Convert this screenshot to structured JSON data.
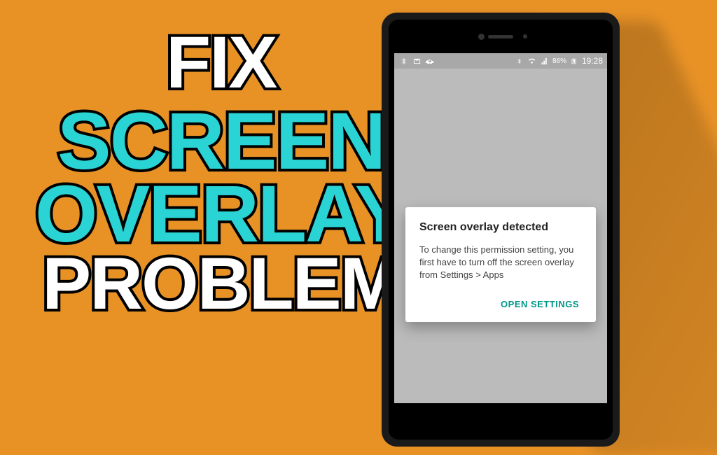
{
  "title": {
    "line1": "FIX",
    "line2": "SCREEN",
    "line3": "OVERLAY",
    "line4": "PROBLEM"
  },
  "statusbar": {
    "battery": "86%",
    "time": "19:28"
  },
  "dialog": {
    "title": "Screen overlay detected",
    "body": "To change this permission setting, you first have to turn off the screen overlay from Settings > Apps",
    "action": "OPEN SETTINGS"
  }
}
